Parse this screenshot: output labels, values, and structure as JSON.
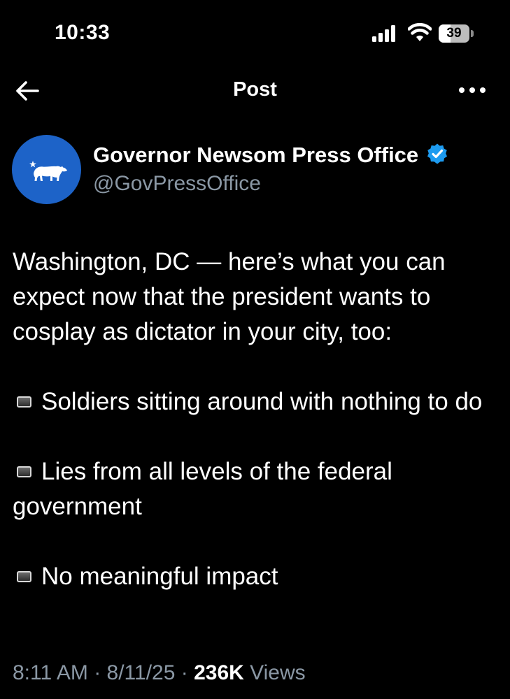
{
  "status_bar": {
    "time": "10:33",
    "battery": "39",
    "battery_level": 0.39,
    "icons": [
      "signal-icon",
      "wifi-icon",
      "battery-icon"
    ]
  },
  "nav": {
    "back_icon": "arrow-left-icon",
    "title": "Post",
    "more_icon": "more-horizontal-icon"
  },
  "author": {
    "name": "Governor Newsom Press Office",
    "handle": "@GovPressOffice",
    "verified": true,
    "avatar_icon": "california-bear-icon",
    "avatar_color": "#1d63c8",
    "verified_color": "#1d9bf0"
  },
  "post": {
    "intro": "Washington, DC — here’s what you can expect now that the president wants to cosplay as dictator in your city, too:",
    "bullets": [
      "Soldiers sitting around with nothing to do",
      "Lies from all levels of the federal government",
      "No meaningful impact"
    ],
    "bullet_icon": "black-square-icon"
  },
  "meta": {
    "time": "8:11 AM",
    "separator": "·",
    "date": "8/11/25",
    "views_count": "236K",
    "views_label": "Views"
  },
  "colors": {
    "background": "#000000",
    "text_primary": "#ffffff",
    "text_secondary": "#8b98a5"
  }
}
